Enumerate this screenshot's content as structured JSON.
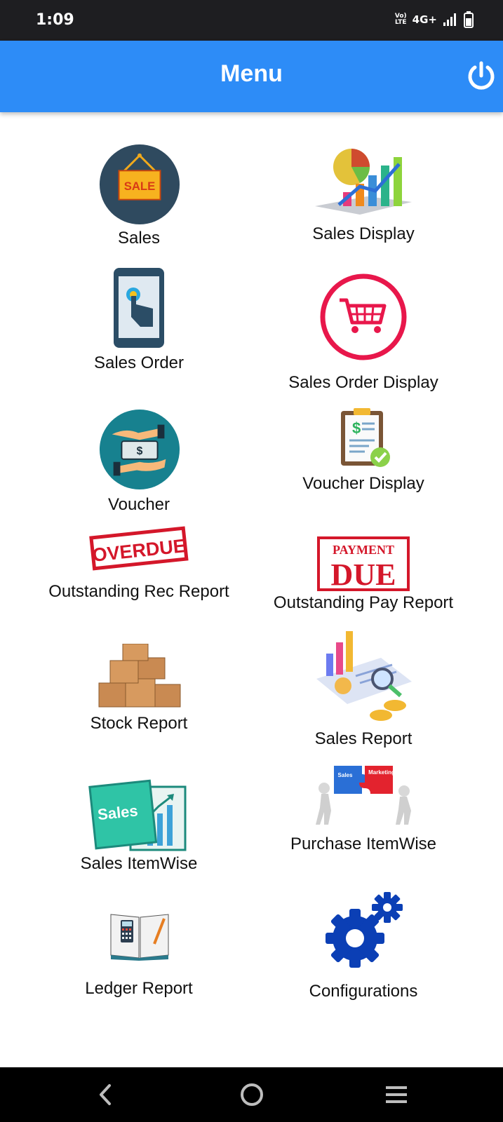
{
  "status_bar": {
    "time": "1:09",
    "volte_top": "Vo)",
    "volte_bottom": "LTE",
    "network": "4G+"
  },
  "app_bar": {
    "title": "Menu",
    "background": "#2d8cf7",
    "power_icon": "power-icon"
  },
  "menu": {
    "sales": "Sales",
    "sales_display": "Sales Display",
    "sales_order": "Sales Order",
    "sales_order_display": "Sales Order Display",
    "voucher": "Voucher",
    "voucher_display": "Voucher Display",
    "outstanding_rec_report": "Outstanding Rec Report",
    "outstanding_pay_report": "Outstanding Pay Report",
    "stock_report": "Stock Report",
    "sales_report": "Sales Report",
    "sales_itemwise": "Sales ItemWise",
    "purchase_itemwise": "Purchase ItemWise",
    "ledger_report": "Ledger Report",
    "configurations": "Configurations"
  },
  "icon_text": {
    "sale_sign": "SALE",
    "overdue_stamp": "OVERDUE",
    "payment_stamp_top": "PAYMENT",
    "payment_stamp_bottom": "DUE",
    "sales_card": "Sales",
    "puzzle_left": "Sales",
    "puzzle_right": "Marketing"
  },
  "nav_bar": {
    "back_icon": "back-icon",
    "home_icon": "home-icon",
    "menu_icon": "menu-icon"
  }
}
